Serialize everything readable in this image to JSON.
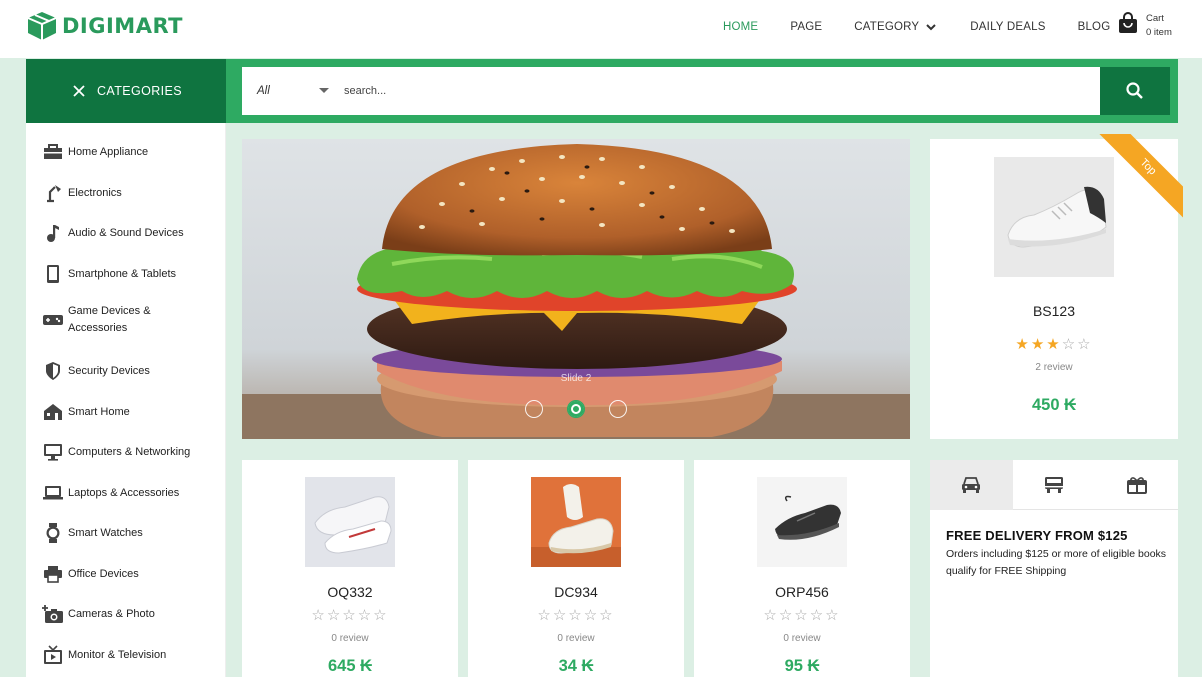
{
  "brand": {
    "name": "DIGIMART",
    "color": "#2a9a5c"
  },
  "nav": {
    "items": [
      {
        "label": "HOME",
        "active": true
      },
      {
        "label": "PAGE"
      },
      {
        "label": "CATEGORY",
        "has_dropdown": true
      },
      {
        "label": "DAILY DEALS"
      },
      {
        "label": "BLOG"
      }
    ]
  },
  "cart": {
    "label": "Cart",
    "count": "0 item"
  },
  "categories": {
    "toggle_label": "CATEGORIES"
  },
  "search": {
    "scope": "All",
    "placeholder": "search..."
  },
  "sidebar": {
    "items": [
      {
        "label": "Home Appliance",
        "icon": "toolbox-icon"
      },
      {
        "label": "Electronics",
        "icon": "desk-lamp-icon"
      },
      {
        "label": "Audio & Sound Devices",
        "icon": "music-note-icon"
      },
      {
        "label": "Smartphone & Tablets",
        "icon": "smartphone-icon"
      },
      {
        "label": "Game Devices & Accessories",
        "icon": "gamepad-icon"
      },
      {
        "label": "Security Devices",
        "icon": "shield-icon"
      },
      {
        "label": "Smart Home",
        "icon": "smart-home-icon"
      },
      {
        "label": "Computers & Networking",
        "icon": "monitor-icon"
      },
      {
        "label": "Laptops & Accessories",
        "icon": "laptop-icon"
      },
      {
        "label": "Smart Watches",
        "icon": "watch-icon"
      },
      {
        "label": "Office Devices",
        "icon": "printer-icon"
      },
      {
        "label": "Cameras & Photo",
        "icon": "camera-icon"
      },
      {
        "label": "Monitor & Television",
        "icon": "tv-icon"
      }
    ]
  },
  "banner": {
    "slide_label": "Slide 2",
    "slide_count": 3,
    "active_slide": 2
  },
  "featured": {
    "name": "BS123",
    "rating": 3,
    "max_rating": 5,
    "reviews": "2 review",
    "price": "450 ₭",
    "ribbon": "Top"
  },
  "products": [
    {
      "name": "OQ332",
      "rating": 0,
      "reviews": "0 review",
      "price": "645 ₭"
    },
    {
      "name": "DC934",
      "rating": 0,
      "reviews": "0 review",
      "price": "34 ₭"
    },
    {
      "name": "ORP456",
      "rating": 0,
      "reviews": "0 review",
      "price": "95 ₭"
    }
  ],
  "delivery": {
    "tabs": [
      "car-icon",
      "bus-icon",
      "gift-icon"
    ],
    "title": "FREE DELIVERY FROM $125",
    "text": "Orders including $125 or more of eligible books qualify for FREE Shipping"
  },
  "colors": {
    "primary": "#2eaa62",
    "dark": "#0f7440",
    "accent": "#f5a623",
    "background": "#dcefe4"
  }
}
